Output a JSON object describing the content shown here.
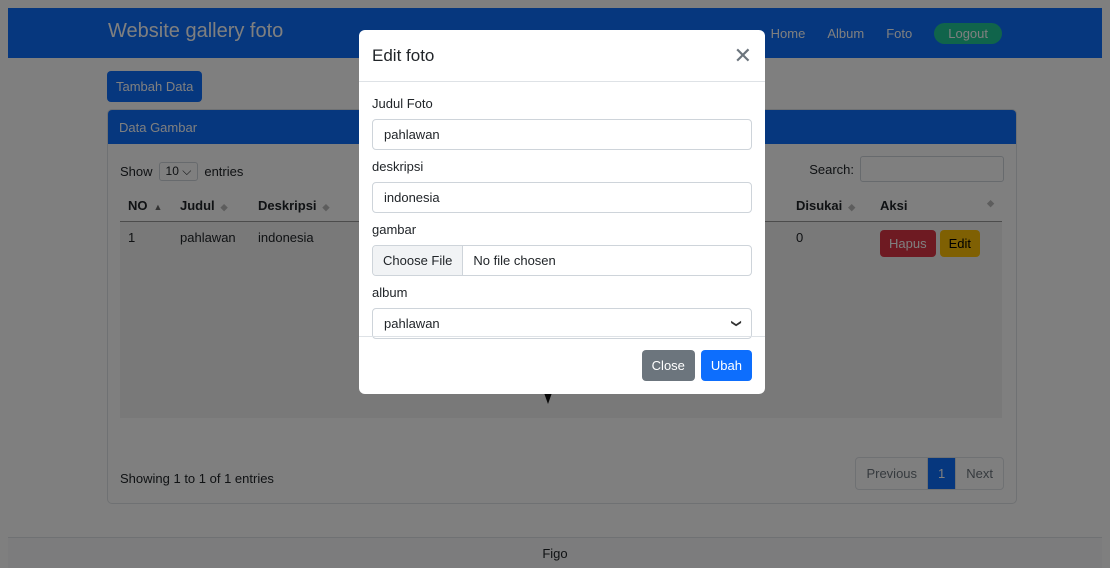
{
  "navbar": {
    "brand": "Website gallery foto",
    "links": [
      "Home",
      "Album",
      "Foto"
    ],
    "logout_label": "Logout"
  },
  "tambah_label": "Tambah Data",
  "card": {
    "header": "Data Gambar",
    "show_label": "Show",
    "entries_value": "10",
    "entries_label": "entries",
    "search_label": "Search:",
    "columns": [
      "NO",
      "Judul",
      "Deskripsi",
      "Disukai",
      "Aksi"
    ],
    "rows": [
      {
        "no": "1",
        "judul": "pahlawan",
        "deskripsi": "indonesia",
        "disukai": "0",
        "hapus": "Hapus",
        "edit": "Edit"
      }
    ],
    "info": "Showing 1 to 1 of 1 entries",
    "pager": {
      "previous": "Previous",
      "page": "1",
      "next": "Next"
    }
  },
  "footer": "Figo",
  "modal": {
    "title": "Edit foto",
    "fields": {
      "judul_label": "Judul Foto",
      "judul_value": "pahlawan",
      "deskripsi_label": "deskripsi",
      "deskripsi_value": "indonesia",
      "gambar_label": "gambar",
      "file_button": "Choose File",
      "file_status": "No file chosen",
      "album_label": "album",
      "album_value": "pahlawan"
    },
    "close_label": "Close",
    "ubah_label": "Ubah"
  },
  "colors": {
    "primary": "#0d6efd",
    "danger": "#dc3545",
    "warning": "#ffc107",
    "secondary": "#6c757d",
    "logout": "#20c997"
  }
}
